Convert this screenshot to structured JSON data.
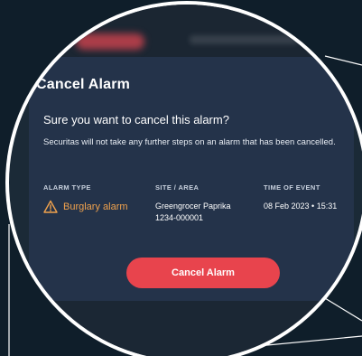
{
  "modal": {
    "title": "Cancel Alarm",
    "question": "Sure you want to cancel this alarm?",
    "note": "Securitas will not take any further steps on an alarm that has been cancelled.",
    "columns": {
      "alarm_type": "ALARM TYPE",
      "site_area": "SITE / AREA",
      "time_of_event": "TIME OF EVENT"
    },
    "alarm": {
      "type_label": "Burglary alarm",
      "site_name": "Greengrocer Paprika",
      "site_id": "1234-000001",
      "time": "08 Feb 2023 • 15:31"
    },
    "cancel_button_label": "Cancel Alarm"
  },
  "icons": {
    "warning": "warning-triangle-icon"
  },
  "colors": {
    "background": "#0f1e2a",
    "modal_bg": "#24334a",
    "accent_red": "#e8444d",
    "warning_orange": "#f0a24d",
    "lens_border": "#ffffff"
  }
}
